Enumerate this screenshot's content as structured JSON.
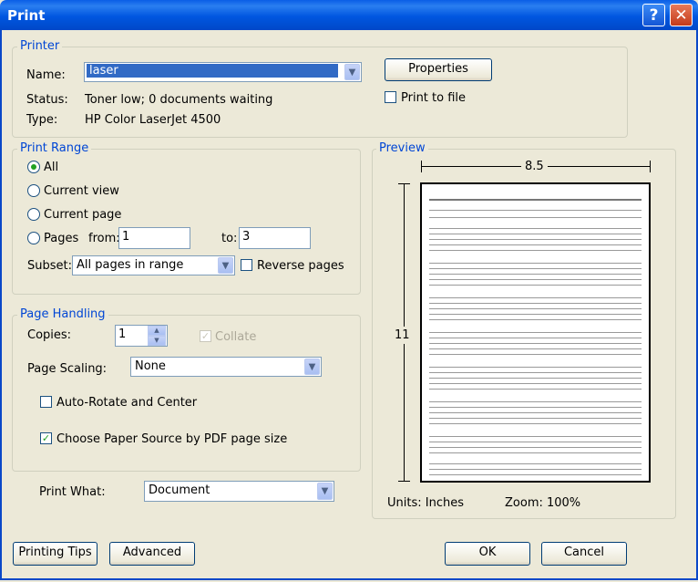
{
  "window": {
    "title": "Print"
  },
  "printer": {
    "group_label": "Printer",
    "name_label": "Name:",
    "name_value": "laser",
    "status_label": "Status:",
    "status_value": "Toner low; 0 documents waiting",
    "type_label": "Type:",
    "type_value": "HP Color LaserJet 4500",
    "properties_label": "Properties",
    "print_to_file_label": "Print to file"
  },
  "print_range": {
    "group_label": "Print Range",
    "all_label": "All",
    "current_view_label": "Current view",
    "current_page_label": "Current page",
    "pages_label": "Pages",
    "from_label": "from:",
    "from_value": "1",
    "to_label": "to:",
    "to_value": "3",
    "subset_label": "Subset:",
    "subset_value": "All pages in range",
    "reverse_label": "Reverse pages"
  },
  "page_handling": {
    "group_label": "Page Handling",
    "copies_label": "Copies:",
    "copies_value": "1",
    "collate_label": "Collate",
    "scaling_label": "Page Scaling:",
    "scaling_value": "None",
    "auto_rotate_label": "Auto-Rotate and Center",
    "choose_source_label": "Choose Paper Source by PDF page size"
  },
  "print_what": {
    "label": "Print What:",
    "value": "Document"
  },
  "preview": {
    "group_label": "Preview",
    "width_label": "8.5",
    "height_label": "11",
    "units_text": "Units: Inches",
    "zoom_text": "Zoom: 100%"
  },
  "buttons": {
    "printing_tips": "Printing Tips",
    "advanced": "Advanced",
    "ok": "OK",
    "cancel": "Cancel"
  }
}
